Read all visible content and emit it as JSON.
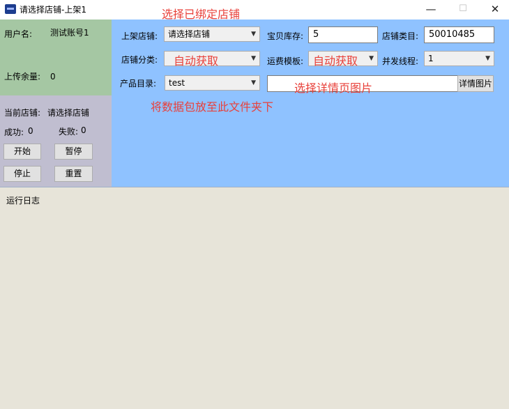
{
  "window": {
    "title": "请选择店铺-上架1",
    "annotation": "选择已绑定店铺",
    "controls": {
      "minimize": "—",
      "maximize": "☐",
      "close": "✕"
    }
  },
  "user_panel": {
    "username_label": "用户名:",
    "username_value": "测试账号1",
    "upload_balance_label": "上传余量:",
    "upload_balance_value": "0"
  },
  "store_panel": {
    "current_store_label": "当前店铺:",
    "current_store_value": "请选择店铺",
    "success_label": "成功:",
    "success_value": "0",
    "fail_label": "失败:",
    "fail_value": "0",
    "buttons": {
      "start": "开始",
      "pause": "暂停",
      "stop": "停止",
      "reset": "重置"
    }
  },
  "config": {
    "shelf_store_label": "上架店铺:",
    "shelf_store_value": "请选择店铺",
    "stock_label": "宝贝库存:",
    "stock_value": "5",
    "store_category_label": "店铺类目:",
    "store_category_value": "50010485",
    "store_class_label": "店铺分类:",
    "store_class_value": "自动获取",
    "shipping_template_label": "运费模板:",
    "shipping_template_value": "自动获取",
    "threads_label": "并发线程:",
    "threads_value": "1",
    "product_dir_label": "产品目录:",
    "product_dir_value": "test",
    "detail_images_placeholder": "选择详情页图片",
    "detail_images_button": "详情图片",
    "product_dir_note": "将数据包放至此文件夹下"
  },
  "log": {
    "label": "运行日志"
  },
  "colors": {
    "user_panel": "#a5c7a3",
    "store_panel": "#c0bed0",
    "config_panel": "#8fc2ff",
    "log_area": "#e7e4d9",
    "annotation_red": "#e8403a"
  }
}
